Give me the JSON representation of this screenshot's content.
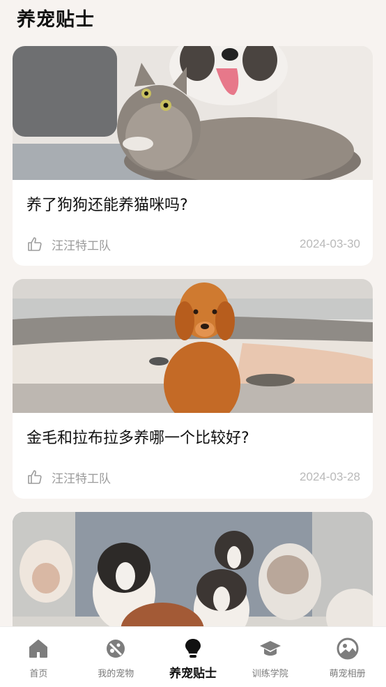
{
  "header": {
    "title": "养宠贴士"
  },
  "articles": [
    {
      "title": "养了狗狗还能养猫咪吗?",
      "author": "汪汪特工队",
      "date": "2024-03-30",
      "image": "cat-and-dog-on-sofa"
    },
    {
      "title": "金毛和拉布拉多养哪一个比较好?",
      "author": "汪汪特工队",
      "date": "2024-03-28",
      "image": "golden-retriever-on-beach"
    },
    {
      "image": "australian-shepherd-puppies"
    }
  ],
  "tabbar": {
    "tabs": [
      {
        "label": "首页",
        "icon": "home-icon"
      },
      {
        "label": "我的宠物",
        "icon": "pet-icon"
      },
      {
        "label": "养宠贴士",
        "icon": "lightbulb-icon",
        "active": true
      },
      {
        "label": "训练学院",
        "icon": "graduation-cap-icon"
      },
      {
        "label": "萌宠相册",
        "icon": "album-icon"
      }
    ]
  },
  "colors": {
    "background": "#f7f3f0",
    "icon_inactive": "#7d7d7d",
    "active": "#111111"
  }
}
